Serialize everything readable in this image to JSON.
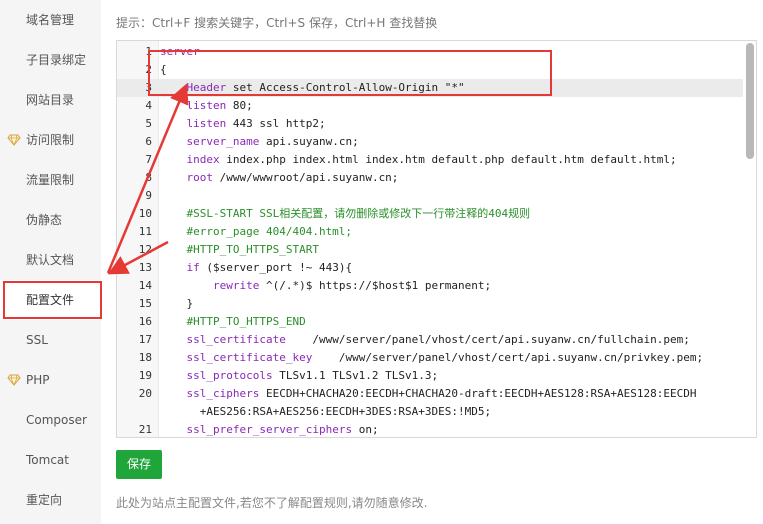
{
  "sidebar": {
    "items": [
      {
        "label": "域名管理",
        "vip": false
      },
      {
        "label": "子目录绑定",
        "vip": false
      },
      {
        "label": "网站目录",
        "vip": false
      },
      {
        "label": "访问限制",
        "vip": true
      },
      {
        "label": "流量限制",
        "vip": false
      },
      {
        "label": "伪静态",
        "vip": false
      },
      {
        "label": "默认文档",
        "vip": false
      },
      {
        "label": "配置文件",
        "vip": false,
        "active": true
      },
      {
        "label": "SSL",
        "vip": false
      },
      {
        "label": "PHP",
        "vip": true
      },
      {
        "label": "Composer",
        "vip": false
      },
      {
        "label": "Tomcat",
        "vip": false
      },
      {
        "label": "重定向",
        "vip": false
      }
    ]
  },
  "editor": {
    "hint": "提示：Ctrl+F 搜索关键字，Ctrl+S 保存，Ctrl+H 查找替换",
    "lines": [
      {
        "num": "1",
        "text": "server"
      },
      {
        "num": "2",
        "text": "{"
      },
      {
        "num": "3",
        "text": "    Header set Access-Control-Allow-Origin \"*\""
      },
      {
        "num": "4",
        "text": "    listen 80;"
      },
      {
        "num": "5",
        "text": "    listen 443 ssl http2;"
      },
      {
        "num": "6",
        "text": "    server_name api.suyanw.cn;"
      },
      {
        "num": "7",
        "text": "    index index.php index.html index.htm default.php default.htm default.html;"
      },
      {
        "num": "8",
        "text": "    root /www/wwwroot/api.suyanw.cn;"
      },
      {
        "num": "9",
        "text": ""
      },
      {
        "num": "10",
        "text": "    #SSL-START SSL相关配置，请勿删除或修改下一行带注释的404规则"
      },
      {
        "num": "11",
        "text": "    #error_page 404/404.html;"
      },
      {
        "num": "12",
        "text": "    #HTTP_TO_HTTPS_START"
      },
      {
        "num": "13",
        "text": "    if ($server_port !~ 443){"
      },
      {
        "num": "14",
        "text": "        rewrite ^(/.*)$ https://$host$1 permanent;"
      },
      {
        "num": "15",
        "text": "    }"
      },
      {
        "num": "16",
        "text": "    #HTTP_TO_HTTPS_END"
      },
      {
        "num": "17",
        "text": "    ssl_certificate    /www/server/panel/vhost/cert/api.suyanw.cn/fullchain.pem;"
      },
      {
        "num": "18",
        "text": "    ssl_certificate_key    /www/server/panel/vhost/cert/api.suyanw.cn/privkey.pem;"
      },
      {
        "num": "19",
        "text": "    ssl_protocols TLSv1.1 TLSv1.2 TLSv1.3;"
      },
      {
        "num": "20",
        "text": "    ssl_ciphers EECDH+CHACHA20:EECDH+CHACHA20-draft:EECDH+AES128:RSA+AES128:EECDH"
      },
      {
        "num": "",
        "text": "      +AES256:RSA+AES256:EECDH+3DES:RSA+3DES:!MD5;"
      },
      {
        "num": "21",
        "text": "    ssl_prefer_server_ciphers on;"
      }
    ]
  },
  "actions": {
    "save_label": "保存"
  },
  "footer": {
    "note": "此处为站点主配置文件,若您不了解配置规则,请勿随意修改."
  },
  "colors": {
    "accent_green": "#20a53a",
    "annotation_red": "#e53935",
    "keyword_purple": "#8b28b8",
    "comment_green": "#2a8f2a"
  },
  "icons": {
    "vip": "diamond-vip-icon"
  }
}
